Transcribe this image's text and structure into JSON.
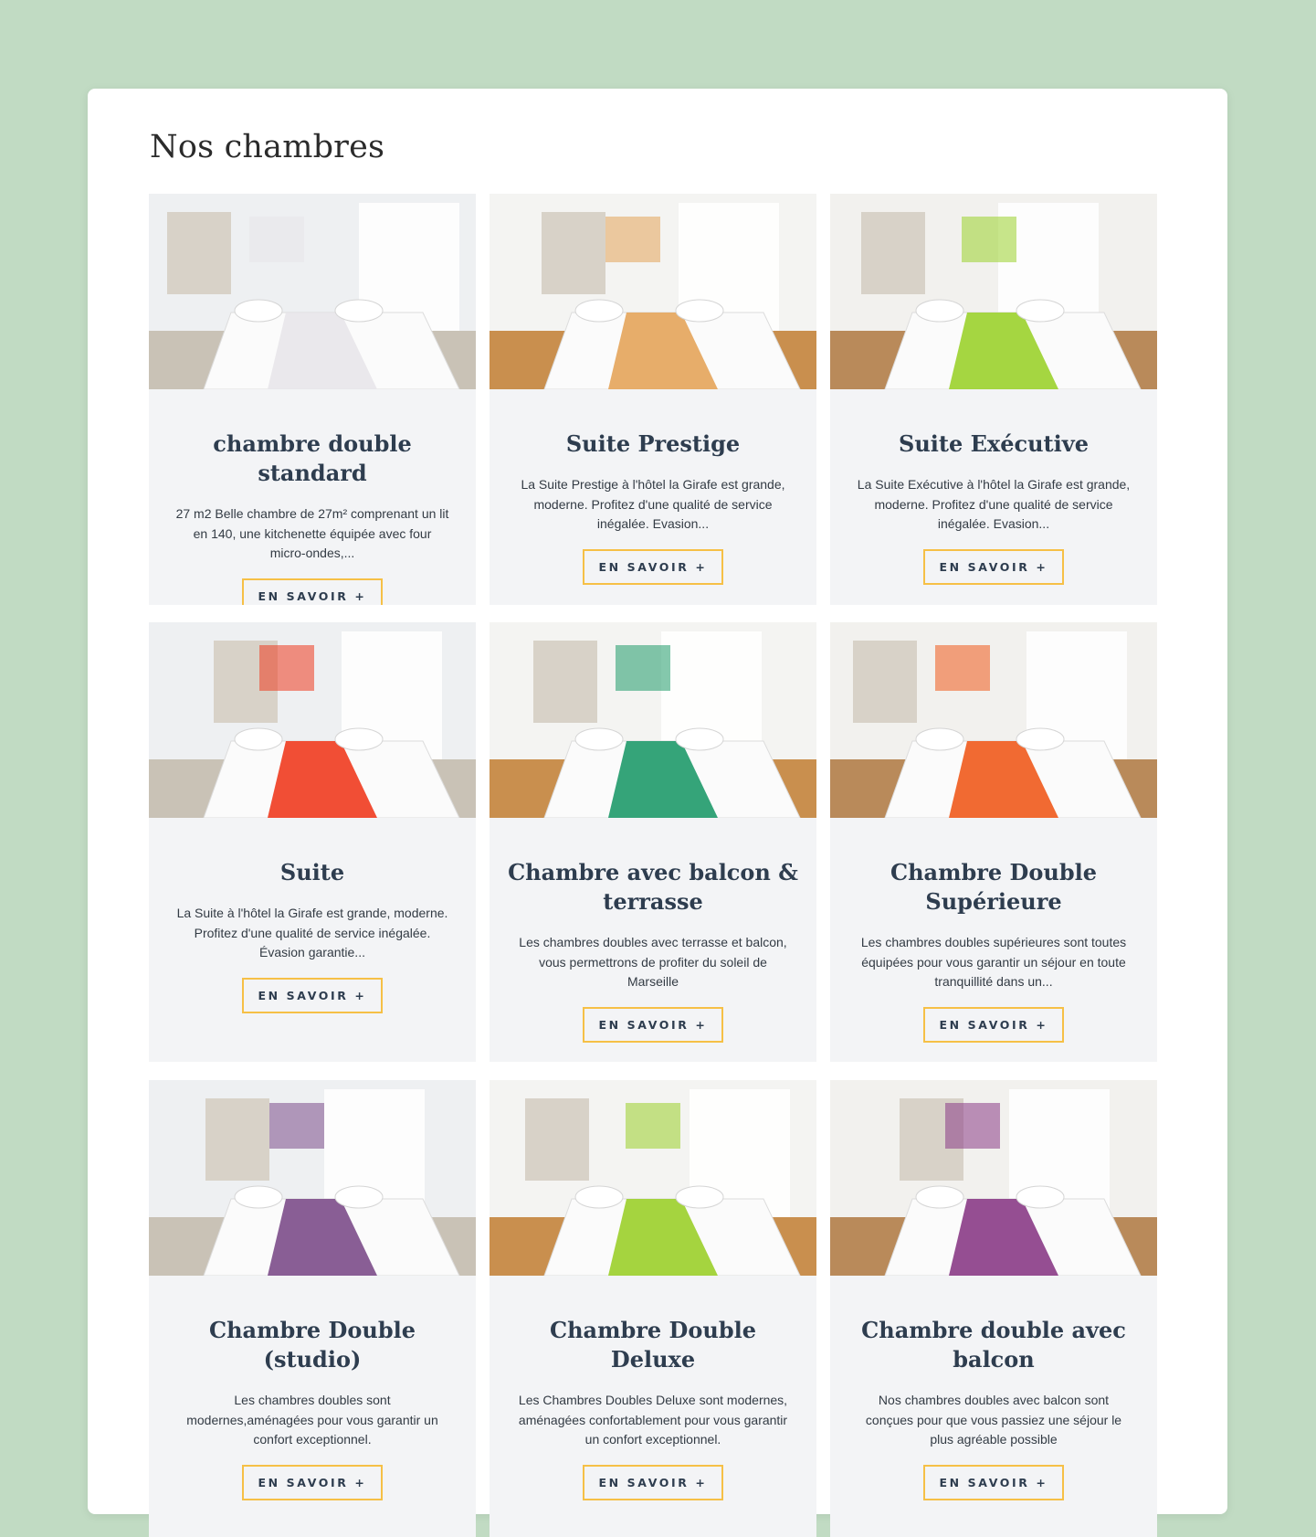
{
  "section": {
    "title": "Nos chambres"
  },
  "rooms": [
    {
      "title": "chambre double standard",
      "description": "27 m2 Belle chambre de 27m² comprenant un lit en 140, une kitchenette équipée avec four micro-ondes,...",
      "button": "EN SAVOIR +",
      "accent": "#e8e6ea"
    },
    {
      "title": "Suite Prestige",
      "description": "La Suite Prestige à l'hôtel la Girafe est grande, moderne. Profitez d'une qualité de service inégalée. Evasion...",
      "button": "EN SAVOIR +",
      "accent": "#e4a45a"
    },
    {
      "title": "Suite Exécutive",
      "description": "La Suite Exécutive à l'hôtel la Girafe est grande, moderne. Profitez d'une qualité de service inégalée. Evasion...",
      "button": "EN SAVOIR +",
      "accent": "#9bd22c"
    },
    {
      "title": "Suite",
      "description": "La Suite à l'hôtel la Girafe est grande, moderne. Profitez d'une qualité de service inégalée. Évasion garantie...",
      "button": "EN SAVOIR +",
      "accent": "#ef3b1f"
    },
    {
      "title": "Chambre avec balcon & terrasse",
      "description": "Les chambres doubles avec terrasse et balcon, vous permettrons de profiter du soleil de Marseille",
      "button": "EN SAVOIR +",
      "accent": "#1f9a6a"
    },
    {
      "title": "Chambre Double Supérieure",
      "description": "Les chambres doubles supérieures sont toutes équipées pour vous garantir un séjour en toute tranquillité dans un...",
      "button": "EN SAVOIR +",
      "accent": "#f05a1c"
    },
    {
      "title": "Chambre Double (studio)",
      "description": "Les chambres doubles sont modernes,aménagées pour vous garantir un confort exceptionnel.",
      "button": "EN SAVOIR +",
      "accent": "#7c4d8a"
    },
    {
      "title": "Chambre Double Deluxe",
      "description": "Les Chambres Doubles Deluxe sont modernes, aménagées confortablement pour vous garantir un confort exceptionnel.",
      "button": "EN SAVOIR +",
      "accent": "#9bcf2a"
    },
    {
      "title": "Chambre double avec balcon",
      "description": "Nos chambres doubles avec balcon sont conçues pour que vous passiez une séjour le plus agréable possible",
      "button": "EN SAVOIR +",
      "accent": "#8a3b86"
    }
  ]
}
